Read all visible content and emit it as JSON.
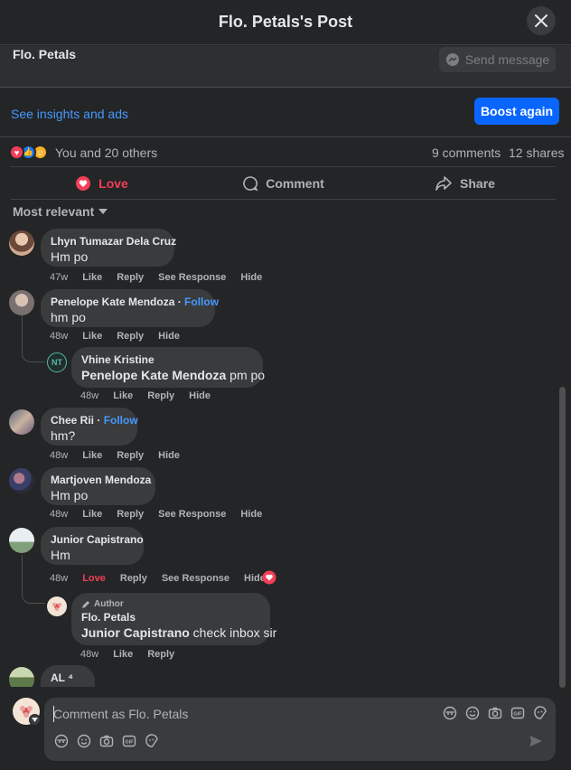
{
  "header": {
    "title": "Flo. Petals's Post"
  },
  "page_strip": {
    "name": "Flo. Petals",
    "send_message": "Send message"
  },
  "insights": {
    "link": "See insights and ads",
    "boost": "Boost again"
  },
  "reactions": {
    "text": "You and 20 others",
    "comments": "9 comments",
    "shares": "12 shares"
  },
  "actions": {
    "love": "Love",
    "comment": "Comment",
    "share": "Share"
  },
  "sort": {
    "label": "Most relevant"
  },
  "comments": [
    {
      "name": "Lhyn Tumazar Dela Cruz",
      "text": "Hm po",
      "time": "47w",
      "like": "Like",
      "reply": "Reply",
      "see_response": "See Response",
      "hide": "Hide"
    },
    {
      "name": "Penelope Kate Mendoza",
      "follow": "Follow",
      "text": "hm po",
      "time": "48w",
      "like": "Like",
      "reply": "Reply",
      "hide": "Hide"
    },
    {
      "name": "Vhine Kristine",
      "mention": "Penelope Kate Mendoza",
      "text": " pm po",
      "time": "48w",
      "like": "Like",
      "reply": "Reply",
      "hide": "Hide"
    },
    {
      "name": "Chee Rii",
      "follow": "Follow",
      "text": "hm?",
      "time": "48w",
      "like": "Like",
      "reply": "Reply",
      "hide": "Hide"
    },
    {
      "name": "Martjoven Mendoza",
      "text": "Hm po",
      "time": "48w",
      "like": "Like",
      "reply": "Reply",
      "see_response": "See Response",
      "hide": "Hide"
    },
    {
      "name": "Junior Capistrano",
      "text": "Hm",
      "time": "48w",
      "love": "Love",
      "reply": "Reply",
      "see_response": "See Response",
      "hide": "Hide"
    },
    {
      "author_tag": "Author",
      "name": "Flo. Petals",
      "mention": "Junior Capistrano",
      "text": " check inbox sir",
      "time": "48w",
      "like": "Like",
      "reply": "Reply"
    },
    {
      "name": "AL ⁴"
    }
  ],
  "composer": {
    "placeholder": "Comment as Flo. Petals"
  },
  "colors": {
    "accent": "#0866ff",
    "link": "#4599ff",
    "love": "#f33e58",
    "background": "#242526",
    "bubble": "#3a3b3c"
  },
  "icons": [
    "close-icon",
    "messenger-icon",
    "like-reaction-icon",
    "love-reaction-icon",
    "care-reaction-icon",
    "heart-icon",
    "comment-icon",
    "share-icon",
    "caret-down-icon",
    "pencil-icon",
    "avatar-sticker-icon",
    "emoji-icon",
    "camera-icon",
    "gif-icon",
    "sticker-icon",
    "send-icon"
  ]
}
